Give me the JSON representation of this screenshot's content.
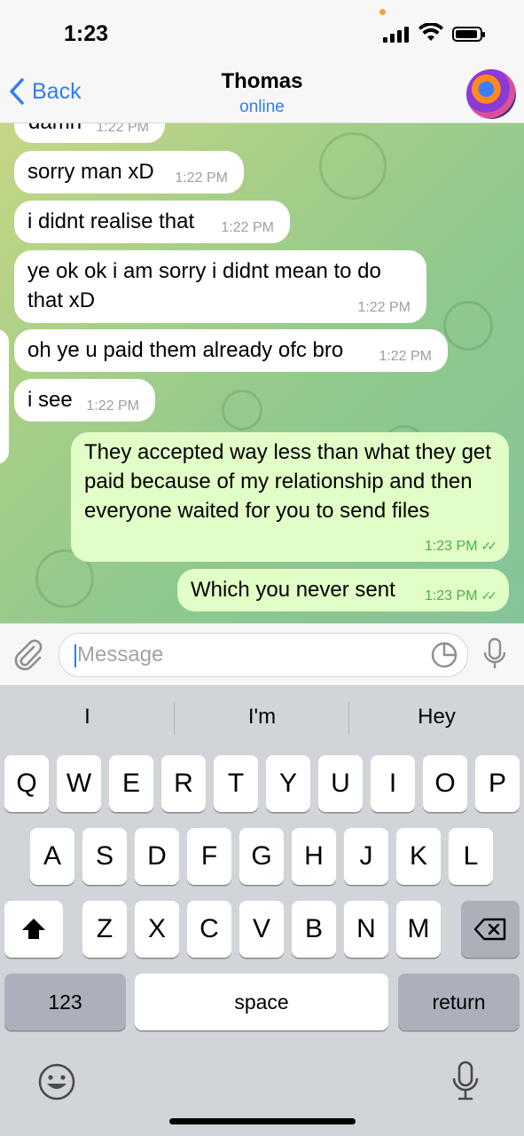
{
  "status_bar": {
    "time": "1:23"
  },
  "nav": {
    "back_label": "Back",
    "contact_name": "Thomas",
    "contact_status": "online"
  },
  "messages": [
    {
      "text": "damn",
      "time": "1:22 PM"
    },
    {
      "text": "sorry man xD",
      "time": "1:22 PM"
    },
    {
      "text": "i didnt realise that",
      "time": "1:22 PM"
    },
    {
      "text": "ye ok ok i am sorry i didnt mean to do that xD",
      "time": "1:22 PM"
    },
    {
      "text": "oh ye u paid them already ofc bro",
      "time": "1:22 PM"
    },
    {
      "text": "i see",
      "time": "1:22 PM"
    },
    {
      "text": "They accepted way less than what they get paid because of my relationship and then everyone waited for you to send files",
      "time": "1:23 PM"
    },
    {
      "text": "Which you never sent",
      "time": "1:23 PM"
    }
  ],
  "input": {
    "placeholder": "Message"
  },
  "keyboard": {
    "suggestions": [
      "I",
      "I'm",
      "Hey"
    ],
    "row1": [
      "Q",
      "W",
      "E",
      "R",
      "T",
      "Y",
      "U",
      "I",
      "O",
      "P"
    ],
    "row2": [
      "A",
      "S",
      "D",
      "F",
      "G",
      "H",
      "J",
      "K",
      "L"
    ],
    "row3": [
      "Z",
      "X",
      "C",
      "V",
      "B",
      "N",
      "M"
    ],
    "numbers_label": "123",
    "space_label": "space",
    "return_label": "return"
  },
  "colors": {
    "accent": "#2f7df6",
    "outgoing_bubble": "#e1fec6",
    "incoming_bubble": "#ffffff",
    "read_check": "#4fae4e"
  }
}
